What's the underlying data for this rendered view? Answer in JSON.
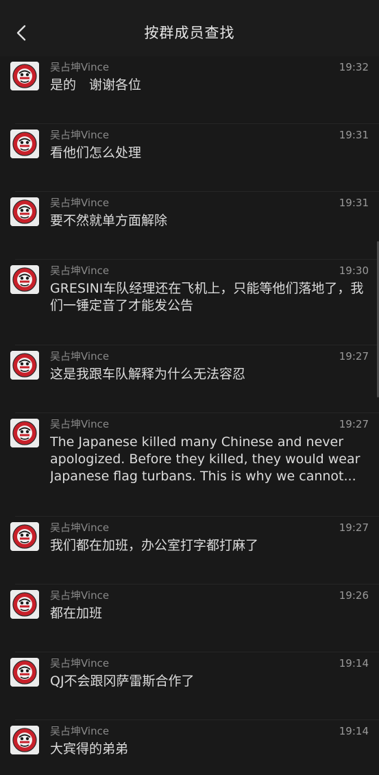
{
  "header": {
    "title": "按群成员查找",
    "back_icon": "chevron-left-icon"
  },
  "messages": [
    {
      "sender": "吴占坤Vince",
      "time": "19:32",
      "content": "是的　谢谢各位"
    },
    {
      "sender": "吴占坤Vince",
      "time": "19:31",
      "content": "看他们怎么处理"
    },
    {
      "sender": "吴占坤Vince",
      "time": "19:31",
      "content": "要不然就单方面解除"
    },
    {
      "sender": "吴占坤Vince",
      "time": "19:30",
      "content": "GRESINI车队经理还在飞机上，只能等他们落地了，我们一锤定音了才能发公告"
    },
    {
      "sender": "吴占坤Vince",
      "time": "19:27",
      "content": "这是我跟车队解释为什么无法容忍"
    },
    {
      "sender": "吴占坤Vince",
      "time": "19:27",
      "content": "The Japanese killed many Chinese and never apologized. Before they killed, they would wear Japanese flag turbans. This is why we cannot..."
    },
    {
      "sender": "吴占坤Vince",
      "time": "19:27",
      "content": "我们都在加班，办公室打字都打麻了"
    },
    {
      "sender": "吴占坤Vince",
      "time": "19:26",
      "content": "都在加班"
    },
    {
      "sender": "吴占坤Vince",
      "time": "19:14",
      "content": "QJ不会跟冈萨雷斯合作了"
    },
    {
      "sender": "吴占坤Vince",
      "time": "19:14",
      "content": "大宾得的弟弟"
    }
  ],
  "colors": {
    "background": "#191919",
    "header": "#1c1c1c",
    "avatar_red": "#c8202a"
  }
}
